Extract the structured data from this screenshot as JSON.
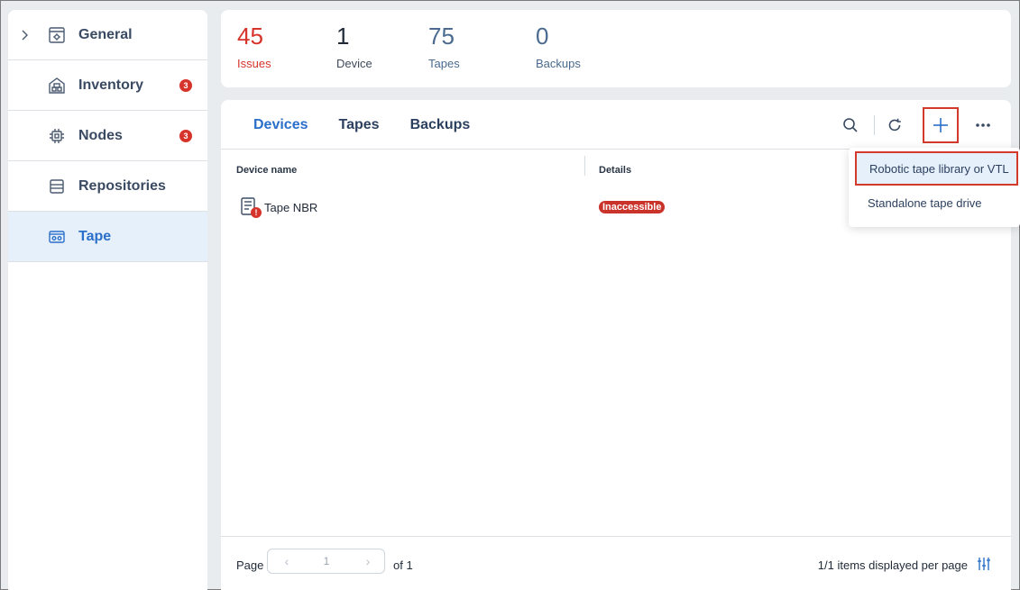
{
  "sidebar": {
    "items": [
      {
        "label": "General",
        "icon": "gear-box-icon",
        "badge": ""
      },
      {
        "label": "Inventory",
        "icon": "inventory-icon",
        "badge": "3"
      },
      {
        "label": "Nodes",
        "icon": "chip-icon",
        "badge": "3"
      },
      {
        "label": "Repositories",
        "icon": "database-icon",
        "badge": ""
      },
      {
        "label": "Tape",
        "icon": "tape-icon",
        "badge": ""
      }
    ]
  },
  "stats": [
    {
      "value": "45",
      "label": "Issues"
    },
    {
      "value": "1",
      "label": "Device"
    },
    {
      "value": "75",
      "label": "Tapes"
    },
    {
      "value": "0",
      "label": "Backups"
    }
  ],
  "tabs": [
    "Devices",
    "Tapes",
    "Backups"
  ],
  "table": {
    "columns": [
      "Device name",
      "Details"
    ],
    "rows": [
      {
        "name": "Tape NBR",
        "status": "Inaccessible"
      }
    ]
  },
  "footer": {
    "page_label": "Page",
    "page_number": "1",
    "of_label": "of 1",
    "per_page": "1/1 items displayed per page"
  },
  "dropdown": {
    "items": [
      "Robotic tape library or VTL",
      "Standalone tape drive"
    ]
  },
  "colors": {
    "accent": "#2a6fc9",
    "error": "#d6332a",
    "highlight_border": "#d43a2c"
  }
}
